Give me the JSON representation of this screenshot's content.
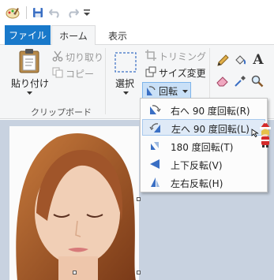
{
  "tabs": {
    "file": "ファイル",
    "home": "ホーム",
    "view": "表示"
  },
  "clipboard": {
    "paste_label": "貼り付け",
    "cut_label": "切り取り",
    "copy_label": "コピー",
    "group_label": "クリップボード"
  },
  "image": {
    "select_label": "選択",
    "crop_label": "トリミング",
    "resize_label": "サイズ変更",
    "rotate_label": "回転"
  },
  "rotate_menu": {
    "items": [
      {
        "label": "右へ 90 度回転(R)",
        "icon": "rotate-right-icon"
      },
      {
        "label": "左へ 90 度回転(L)",
        "icon": "rotate-left-icon"
      },
      {
        "label": "180 度回転(T)",
        "icon": "rotate-180-icon"
      },
      {
        "label": "上下反転(V)",
        "icon": "flip-vertical-icon"
      },
      {
        "label": "左右反転(H)",
        "icon": "flip-horizontal-icon"
      }
    ],
    "highlighted_index": 1
  },
  "colors": {
    "file_tab": "#1979ca",
    "ribbon_bg": "#f5f6f7",
    "canvas_bg": "#c8d2e0",
    "menu_highlight": "#dfeaf7"
  }
}
